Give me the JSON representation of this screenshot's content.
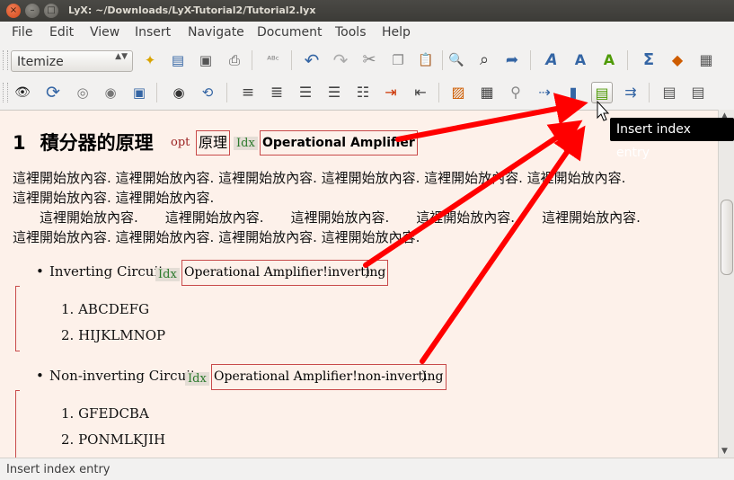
{
  "window": {
    "title": "LyX: ~/Downloads/LyX-Tutorial2/Tutorial2.lyx",
    "close_glyph": "×",
    "min_glyph": "–",
    "max_glyph": "□"
  },
  "menu": [
    "File",
    "Edit",
    "View",
    "Insert",
    "Navigate",
    "Document",
    "Tools",
    "Help"
  ],
  "toolbar": {
    "paragraph_style": "Itemize",
    "paragraph_style_arrows": "▲▼"
  },
  "icons": {
    "new": "✦",
    "open": "▤",
    "save": "▣",
    "print": "⎙",
    "spell": "ᴬᴮᶜ",
    "undo": "↶",
    "redo": "↷",
    "cut": "✂",
    "copy": "❐",
    "paste": "📋",
    "find": "🔍",
    "zoom": "⌕",
    "insert": "➦",
    "font": "A",
    "fontstyle": "A",
    "text": "A",
    "math": "Σ",
    "shapes": "◆",
    "table": "▦",
    "view": "👁",
    "update": "⟳",
    "view_other": "◎",
    "update_other": "◉",
    "view_master": "▣",
    "ext_view": "◉",
    "ext_update": "⟲",
    "normal": "≡",
    "enum": "≣",
    "itemize": "☰",
    "desc": "☰",
    "list": "☷",
    "depth_in": "⇥",
    "depth_out": "⇤",
    "float_fig": "▨",
    "float_tab": "▦",
    "label": "⚲",
    "cross_ref": "⇢",
    "citation": "▮",
    "index_entry": "▤",
    "nomencl": "⇉",
    "toc": "▤",
    "file_list": "▤"
  },
  "document": {
    "section_number": "1",
    "section_title": "積分器的原理",
    "opt_label": "opt",
    "opt_text": "原理",
    "idx_label": "Idx",
    "section_index_entry": "Operational Amplifier",
    "para1_line1": "這裡開始放內容. 這裡開始放內容. 這裡開始放內容. 這裡開始放內容. 這裡開始放內容. 這裡開始放內容.",
    "para1_line2": "這裡開始放內容. 這裡開始放內容.",
    "para2_line1": "　　這裡開始放內容.　　這裡開始放內容.　　這裡開始放內容.　　這裡開始放內容.　　這裡開始放內容.",
    "para2_line2": "這裡開始放內容. 這裡開始放內容. 這裡開始放內容. 這裡開始放內容.",
    "bullet_glyph": "•",
    "item1_text": "Inverting Circuit",
    "item1_index_entry": "Operational Amplifier!inverting",
    "item1_close": ")",
    "item1_sub": [
      "1.  ABCDEFG",
      "2.  HIJKLMNOP"
    ],
    "item2_text": "Non-inverting Circuit",
    "item2_index_entry": "Operational Amplifier!non-inverting",
    "item2_close": ")",
    "item2_sub": [
      "1.  GFEDCBA",
      "2.  PONMLKJIH"
    ]
  },
  "tooltip": "Insert index entry",
  "status": "Insert index entry",
  "colors": {
    "annotation_arrow": "#ff0000",
    "inset_border": "#c84a4a",
    "idx_label": "#2c7a2c",
    "opt_label": "#9b2222",
    "document_background": "#fdf1ea"
  }
}
